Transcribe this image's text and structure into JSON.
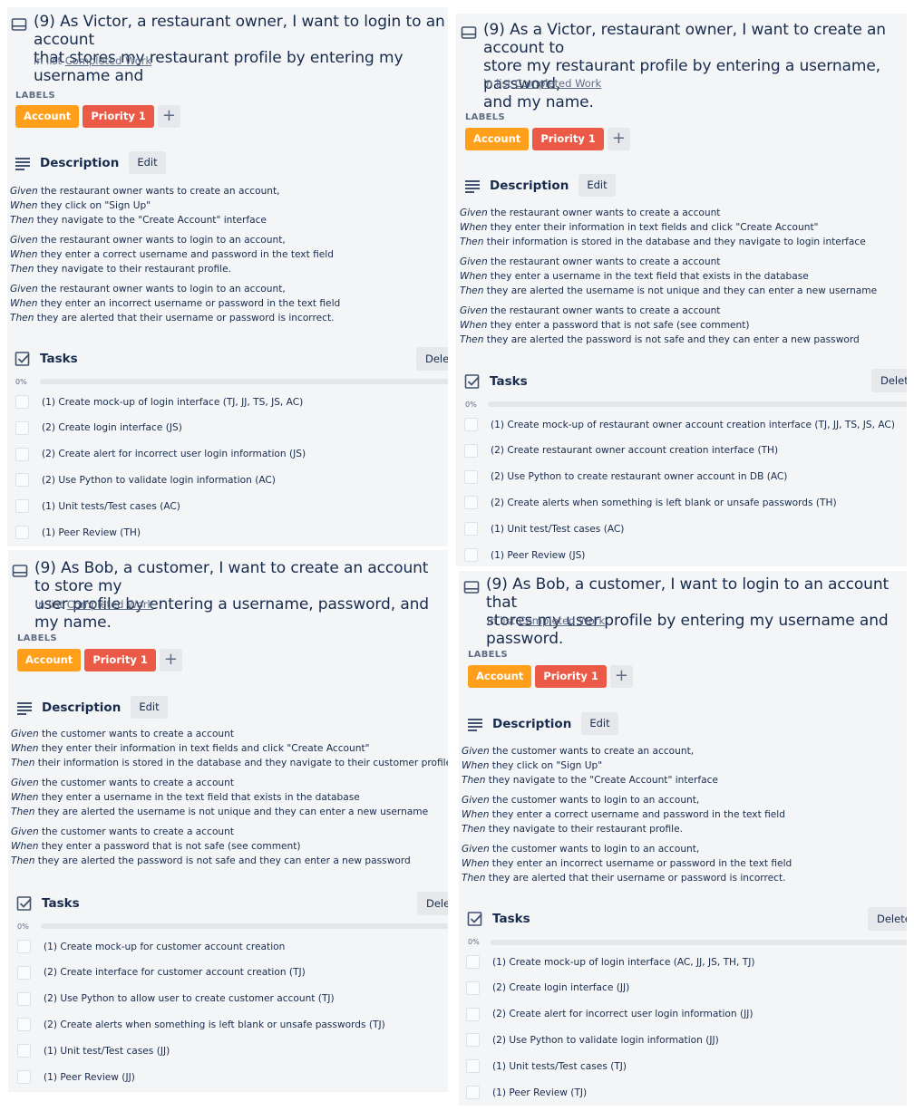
{
  "cards": [
    {
      "title": "(9) As Victor, a restaurant owner, I want to login to an account\nthat stores my restaurant profile by entering my username and",
      "in_list_prefix": "in list",
      "list_name": "Completed Work",
      "labels_title": "LABELS",
      "labels": [
        {
          "text": "Account",
          "color": "#ff9f1a"
        },
        {
          "text": "Priority 1",
          "color": "#eb5a46"
        }
      ],
      "add_label": "+",
      "description_title": "Description",
      "edit_label": "Edit",
      "description": [
        [
          {
            "kw": "Given",
            "text": " the restaurant owner wants to create an account,"
          },
          {
            "kw": "When",
            "text": " they click on \"Sign Up\""
          },
          {
            "kw": "Then",
            "text": " they navigate to the \"Create Account\" interface"
          }
        ],
        [
          {
            "kw": "Given",
            "text": " the restaurant owner wants to login to an account,"
          },
          {
            "kw": "When",
            "text": " they enter a correct username and password in the text field"
          },
          {
            "kw": "Then",
            "text": " they navigate to their restaurant profile."
          }
        ],
        [
          {
            "kw": "Given",
            "text": " the restaurant owner wants to login to an account,"
          },
          {
            "kw": "When",
            "text": " they enter an incorrect username or password in the text field"
          },
          {
            "kw": "Then",
            "text": " they are alerted that their username or password is incorrect."
          }
        ]
      ],
      "tasks_title": "Tasks",
      "delete_label": "Delete",
      "progress_label": "0%",
      "progress": 0,
      "tasks": [
        "(1) Create mock-up of login interface (TJ, JJ, TS, JS, AC)",
        "(2) Create login interface (JS)",
        "(2) Create alert for incorrect user login information (JS)",
        "(2) Use Python to validate login information (AC)",
        "(1) Unit tests/Test cases (AC)",
        "(1) Peer Review (TH)"
      ]
    },
    {
      "title": "(9) As a Victor, restaurant owner, I want to create an account to\nstore my restaurant profile by entering a username, password,\nand my name.",
      "in_list_prefix": "in list",
      "list_name": "Completed Work",
      "labels_title": "LABELS",
      "labels": [
        {
          "text": "Account",
          "color": "#ff9f1a"
        },
        {
          "text": "Priority 1",
          "color": "#eb5a46"
        }
      ],
      "add_label": "+",
      "description_title": "Description",
      "edit_label": "Edit",
      "description": [
        [
          {
            "kw": "Given",
            "text": " the restaurant owner wants to create a account"
          },
          {
            "kw": "When",
            "text": " they enter their information in text fields and click \"Create Account\""
          },
          {
            "kw": "Then",
            "text": " their information is stored in the database and they navigate to login interface"
          }
        ],
        [
          {
            "kw": "Given",
            "text": " the restaurant owner wants to create a account"
          },
          {
            "kw": "When",
            "text": " they enter a username in the text field that exists in the database"
          },
          {
            "kw": "Then",
            "text": " they are alerted the username is not unique and they can enter a new username"
          }
        ],
        [
          {
            "kw": "Given",
            "text": " the restaurant owner wants to create a account"
          },
          {
            "kw": "When",
            "text": " they enter a password that is not safe (see comment)"
          },
          {
            "kw": "Then",
            "text": " they are alerted the password is not safe and they can enter a new password"
          }
        ]
      ],
      "tasks_title": "Tasks",
      "delete_label": "Delete",
      "progress_label": "0%",
      "progress": 0,
      "tasks": [
        "(1) Create mock-up of restaurant owner account creation interface (TJ, JJ, TS, JS, AC)",
        "(2) Create restaurant owner account creation interface (TH)",
        "(2) Use Python to create restaurant owner account in DB (AC)",
        "(2) Create alerts when something is left blank or unsafe passwords (TH)",
        "(1) Unit test/Test cases (AC)",
        "(1) Peer Review (JS)"
      ]
    },
    {
      "title": "(9) As Bob, a customer, I want to create an account to store my\nuser profile by entering a username, password, and my name.",
      "in_list_prefix": "in list",
      "list_name": "Completed Work",
      "labels_title": "LABELS",
      "labels": [
        {
          "text": "Account",
          "color": "#ff9f1a"
        },
        {
          "text": "Priority 1",
          "color": "#eb5a46"
        }
      ],
      "add_label": "+",
      "description_title": "Description",
      "edit_label": "Edit",
      "description": [
        [
          {
            "kw": "Given",
            "text": " the customer wants to create a account"
          },
          {
            "kw": "When",
            "text": " they enter their information in text fields and click \"Create Account\""
          },
          {
            "kw": "Then",
            "text": " their information is stored in the database and they navigate to their customer profile interface"
          }
        ],
        [
          {
            "kw": "Given",
            "text": " the customer wants to create a account"
          },
          {
            "kw": "When",
            "text": " they enter a username in the text field that exists in the database"
          },
          {
            "kw": "Then",
            "text": " they are alerted the username is not unique and they can enter a new username"
          }
        ],
        [
          {
            "kw": "Given",
            "text": " the customer wants to create a account"
          },
          {
            "kw": "When",
            "text": " they enter a password that is not safe (see comment)"
          },
          {
            "kw": "Then",
            "text": " they are alerted the password is not safe and they can enter a new password"
          }
        ]
      ],
      "tasks_title": "Tasks",
      "delete_label": "Delete",
      "progress_label": "0%",
      "progress": 0,
      "tasks": [
        "(1) Create mock-up for customer account creation",
        "(2) Create interface for customer account creation (TJ)",
        "(2) Use Python to allow user to create customer account (TJ)",
        "(2) Create alerts when something is left blank or unsafe passwords (TJ)",
        "(1) Unit test/Test cases (JJ)",
        "(1) Peer Review (JJ)"
      ]
    },
    {
      "title": "(9) As Bob, a customer, I want to login to an account that\nstores my user profile by entering my username and password.",
      "in_list_prefix": "in list",
      "list_name": "Completed Work",
      "labels_title": "LABELS",
      "labels": [
        {
          "text": "Account",
          "color": "#ff9f1a"
        },
        {
          "text": "Priority 1",
          "color": "#eb5a46"
        }
      ],
      "add_label": "+",
      "description_title": "Description",
      "edit_label": "Edit",
      "description": [
        [
          {
            "kw": "Given",
            "text": " the customer wants to create an account,"
          },
          {
            "kw": "When",
            "text": " they click on \"Sign Up\""
          },
          {
            "kw": "Then",
            "text": " they navigate to the \"Create Account\" interface"
          }
        ],
        [
          {
            "kw": "Given",
            "text": " the customer wants to login to an account,"
          },
          {
            "kw": "When",
            "text": " they enter a correct username and password in the text field"
          },
          {
            "kw": "Then",
            "text": " they navigate to their restaurant profile."
          }
        ],
        [
          {
            "kw": "Given",
            "text": " the customer wants to login to an account,"
          },
          {
            "kw": "When",
            "text": " they enter an incorrect username or password in the text field"
          },
          {
            "kw": "Then",
            "text": " they are alerted that their username or password is incorrect."
          }
        ]
      ],
      "tasks_title": "Tasks",
      "delete_label": "Delete",
      "progress_label": "0%",
      "progress": 0,
      "tasks": [
        "(1) Create mock-up of login interface (AC, JJ, JS, TH, TJ)",
        "(2) Create login interface (JJ)",
        "(2) Create alert for incorrect user login information (JJ)",
        "(2) Use Python to validate login information (JJ)",
        "(1) Unit tests/Test cases (TJ)",
        "(1) Peer Review (TJ)"
      ]
    }
  ]
}
